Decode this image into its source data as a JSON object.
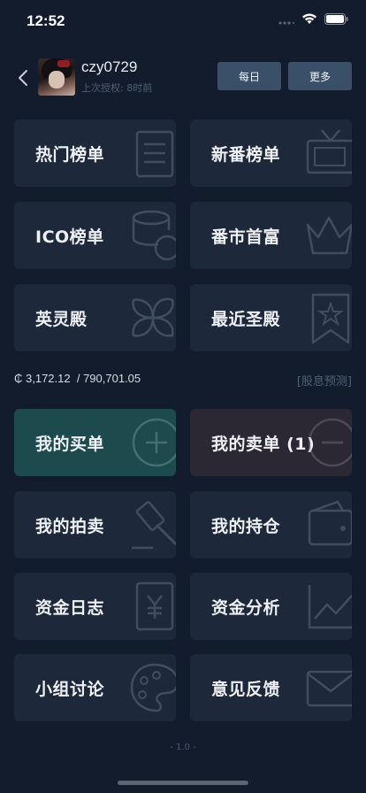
{
  "status_bar": {
    "time": "12:52"
  },
  "profile": {
    "username": "czy0729",
    "last_auth": "上次授权: 8时前"
  },
  "header_buttons": {
    "daily": "每日",
    "more": "更多"
  },
  "menu_top": [
    {
      "label": "热门榜单",
      "icon": "list-icon"
    },
    {
      "label": "新番榜单",
      "icon": "tv-icon"
    },
    {
      "label": "ICO榜单",
      "icon": "coin-stack-icon"
    },
    {
      "label": "番市首富",
      "icon": "crown-icon"
    },
    {
      "label": "英灵殿",
      "icon": "flower-icon"
    },
    {
      "label": "最近圣殿",
      "icon": "bookmark-star-icon"
    }
  ],
  "balance": {
    "amount": "₵ 3,172.12",
    "assets": "/ 790,701.05",
    "predict_link": "[股息预测]"
  },
  "menu_bottom": [
    {
      "label": "我的买单",
      "icon": "plus-circle-icon"
    },
    {
      "label": "我的卖单 (1)",
      "icon": "minus-circle-icon"
    },
    {
      "label": "我的拍卖",
      "icon": "auction-hammer-icon"
    },
    {
      "label": "我的持仓",
      "icon": "wallet-icon"
    },
    {
      "label": "资金日志",
      "icon": "yen-ledger-icon"
    },
    {
      "label": "资金分析",
      "icon": "line-chart-icon"
    },
    {
      "label": "小组讨论",
      "icon": "palette-icon"
    },
    {
      "label": "意见反馈",
      "icon": "mail-icon"
    }
  ],
  "version": "- 1.0 -",
  "colors": {
    "background": "#131c2c",
    "tile": "#1d283a",
    "buy_tile": "#1d4a4c",
    "sell_tile": "#2c2833",
    "header_button": "#3a5068"
  }
}
